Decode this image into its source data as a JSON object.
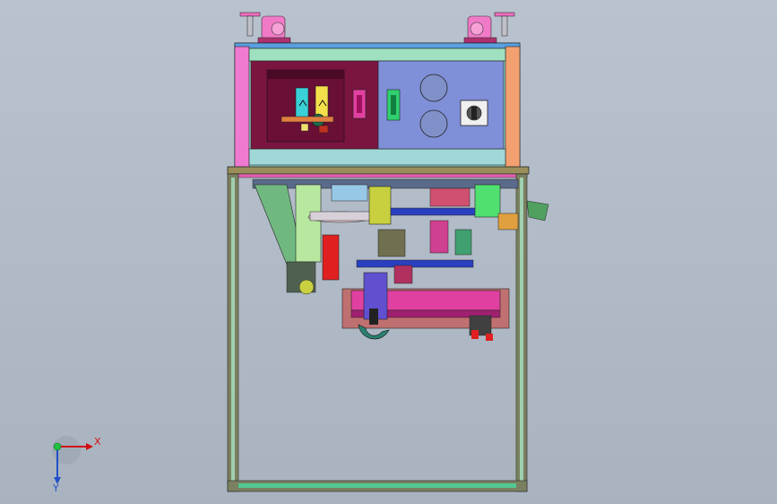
{
  "viewport": {
    "background_top": "#b9c3cf",
    "background_bottom": "#a9b3bf",
    "model": "machine-assembly-front-view"
  },
  "triad": {
    "x_label": "X",
    "y_label": "Y",
    "x_color": "#d01010",
    "y_color": "#2050c8",
    "origin_color": "#20c040"
  },
  "colors": {
    "cabinet_panel_maroon": "#7a1540",
    "cabinet_panel_blue": "#7f8fd8",
    "frame_green": "#9fd8b8",
    "frame_pink": "#f07ad0",
    "frame_orange": "#f2a070",
    "gauge_cyan": "#39d0d8",
    "gauge_yellow": "#f4e04a",
    "indicator_green": "#30d070",
    "base_frame": "#7a8060"
  }
}
